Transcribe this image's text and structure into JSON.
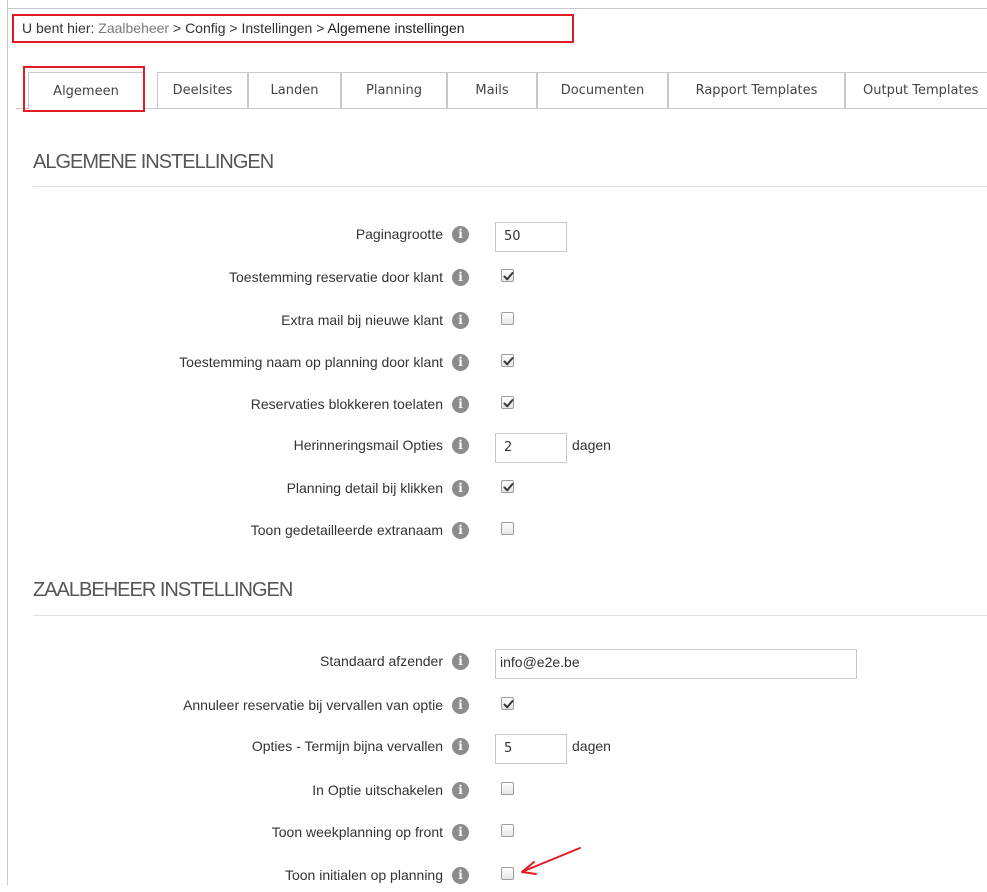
{
  "breadcrumb": {
    "prefix": "U bent hier:",
    "items": [
      "Zaalbeheer",
      "Config",
      "Instellingen",
      "Algemene instellingen"
    ],
    "separator": ">"
  },
  "tabs": [
    "Algemeen",
    "Deelsites",
    "Landen",
    "Planning",
    "Mails",
    "Documenten",
    "Rapport Templates",
    "Output Templates"
  ],
  "active_tab": "Algemeen",
  "sections": [
    {
      "title": "ALGEMENE INSTELLINGEN",
      "fields": [
        {
          "label": "Paginagrootte",
          "type": "text",
          "value": "50"
        },
        {
          "label": "Toestemming reservatie door klant",
          "type": "checkbox",
          "checked": true
        },
        {
          "label": "Extra mail bij nieuwe klant",
          "type": "checkbox",
          "checked": false
        },
        {
          "label": "Toestemming naam op planning door klant",
          "type": "checkbox",
          "checked": true
        },
        {
          "label": "Reservaties blokkeren toelaten",
          "type": "checkbox",
          "checked": true
        },
        {
          "label": "Herinneringsmail Opties",
          "type": "text",
          "value": "2",
          "unit": "dagen"
        },
        {
          "label": "Planning detail bij klikken",
          "type": "checkbox",
          "checked": true
        },
        {
          "label": "Toon gedetailleerde extranaam",
          "type": "checkbox",
          "checked": false
        }
      ]
    },
    {
      "title": "ZAALBEHEER INSTELLINGEN",
      "fields": [
        {
          "label": "Standaard afzender",
          "type": "text",
          "value": "info@e2e.be"
        },
        {
          "label": "Annuleer reservatie bij vervallen van optie",
          "type": "checkbox",
          "checked": true
        },
        {
          "label": "Opties - Termijn bijna vervallen",
          "type": "text",
          "value": "5",
          "unit": "dagen"
        },
        {
          "label": "In Optie uitschakelen",
          "type": "checkbox",
          "checked": false
        },
        {
          "label": "Toon weekplanning op front",
          "type": "checkbox",
          "checked": false
        },
        {
          "label": "Toon initialen op planning",
          "type": "checkbox",
          "checked": false
        }
      ]
    }
  ],
  "icons": {
    "info": "info-circle-icon",
    "annotation": "red-arrow-icon"
  },
  "colors": {
    "highlight": "#e11b22",
    "info_icon": "#8c8c8c"
  }
}
